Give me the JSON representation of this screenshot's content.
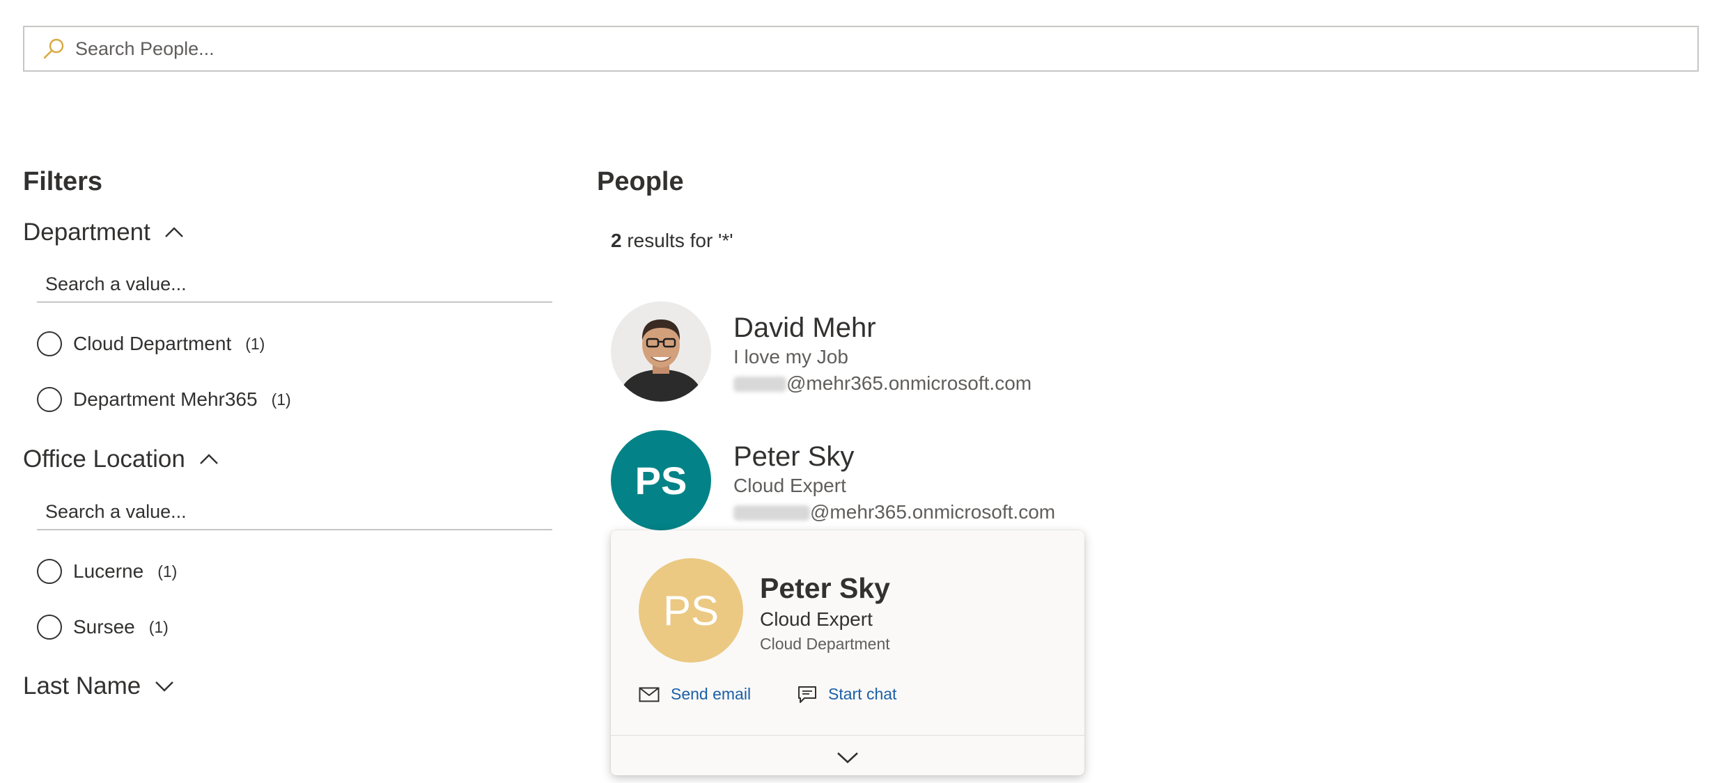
{
  "search": {
    "placeholder": "Search People..."
  },
  "filters": {
    "title": "Filters",
    "groups": [
      {
        "label": "Department",
        "expanded": true,
        "search_placeholder": "Search a value...",
        "options": [
          {
            "label": "Cloud Department",
            "count": "(1)"
          },
          {
            "label": "Department Mehr365",
            "count": "(1)"
          }
        ]
      },
      {
        "label": "Office Location",
        "expanded": true,
        "search_placeholder": "Search a value...",
        "options": [
          {
            "label": "Lucerne",
            "count": "(1)"
          },
          {
            "label": "Sursee",
            "count": "(1)"
          }
        ]
      },
      {
        "label": "Last Name",
        "expanded": false
      }
    ]
  },
  "people": {
    "title": "People",
    "result_count": "2",
    "result_suffix": " results for '*'",
    "results": [
      {
        "name": "David Mehr",
        "job": "I love my Job",
        "email_domain": "@mehr365.onmicrosoft.com",
        "avatar": "photo"
      },
      {
        "name": "Peter Sky",
        "job": "Cloud Expert",
        "email_domain": "@mehr365.onmicrosoft.com",
        "initials": "PS",
        "avatar_color": "#038387"
      }
    ]
  },
  "person_card": {
    "initials": "PS",
    "avatar_color": "#EBC983",
    "name": "Peter Sky",
    "job": "Cloud Expert",
    "department": "Cloud Department",
    "actions": [
      {
        "label": "Send email",
        "icon": "mail-icon"
      },
      {
        "label": "Start chat",
        "icon": "chat-icon"
      }
    ],
    "expand_icon": "chevron-down-icon"
  }
}
